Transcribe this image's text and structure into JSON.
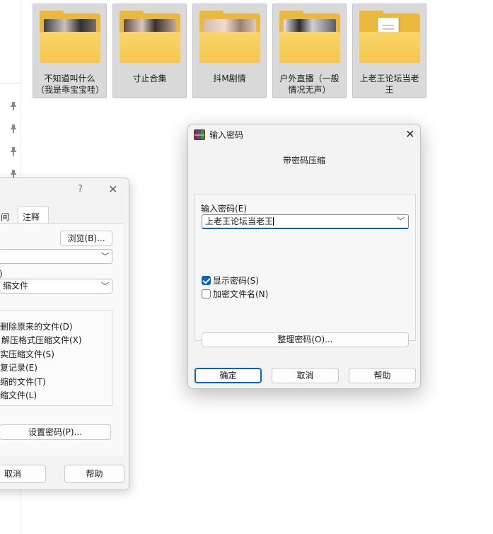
{
  "folders": [
    {
      "label": "不知道叫什么（我是乖宝宝哇）",
      "thumb": "photo"
    },
    {
      "label": "寸止合集",
      "thumb": "photo"
    },
    {
      "label": "抖M剧情",
      "thumb": "photo"
    },
    {
      "label": "户外直播（一般情况无声）",
      "thumb": "photo"
    },
    {
      "label": "上老王论坛当老王",
      "thumb": "document-icon"
    }
  ],
  "left_dialog": {
    "help_glyph": "?",
    "close_glyph": "✕",
    "tab_partial": "间",
    "tab_comment": "注释",
    "browse_label": "浏览(B)...",
    "combo1_value": "",
    "paren_label": ")",
    "combo2_value": "缩文件",
    "options": [
      "删除原来的文件(D)",
      "解压格式压缩文件(X)",
      "实压缩文件(S)",
      "复记录(E)",
      "缩的文件(T)",
      "缩文件(L)"
    ],
    "set_password_label": "设置密码(P)...",
    "cancel_label": "取消",
    "help_label": "帮助"
  },
  "password_dialog": {
    "title": "输入密码",
    "close_glyph": "✕",
    "subtitle": "带密码压缩",
    "password_label": "输入密码(E)",
    "password_value": "上老王论坛当老王",
    "show_password_label": "显示密码(S)",
    "show_password_checked": true,
    "encrypt_names_label": "加密文件名(N)",
    "encrypt_names_checked": false,
    "organize_label": "整理密码(O)...",
    "ok_label": "确定",
    "cancel_label": "取消",
    "help_label": "帮助"
  },
  "colors": {
    "accent": "#0067c0",
    "folder": "#f6c64b",
    "tile_selected": "#d9d9d9"
  },
  "icons": {
    "pins": [
      "pin-icon",
      "pin-icon",
      "pin-icon",
      "pin-icon"
    ],
    "dropdown": "chevron-down-icon",
    "app": "winrar-icon"
  }
}
